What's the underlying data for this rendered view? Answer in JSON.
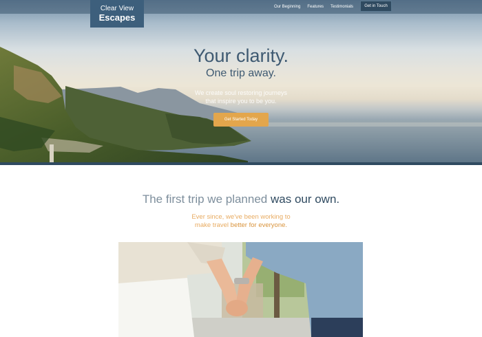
{
  "nav": {
    "logo_line1": "Clear View",
    "logo_line2": "Escapes",
    "links": [
      "Our Beginning",
      "Features",
      "Testimonials"
    ],
    "cta": "Get in Touch"
  },
  "hero": {
    "title": "Your clarity.",
    "subtitle": "One trip away.",
    "description_line1": "We create soul restoring journeys",
    "description_line2": "that inspire you to be you.",
    "button": "Get Started Today"
  },
  "story": {
    "heading_light": "The first trip we planned",
    "heading_strong": "was our own.",
    "copy_line1": "Ever since, we've been working to",
    "copy_line2": "make travel",
    "copy_strong": "better for everyone."
  },
  "colors": {
    "primary": "#2f4a60",
    "accent": "#e3a64c"
  }
}
